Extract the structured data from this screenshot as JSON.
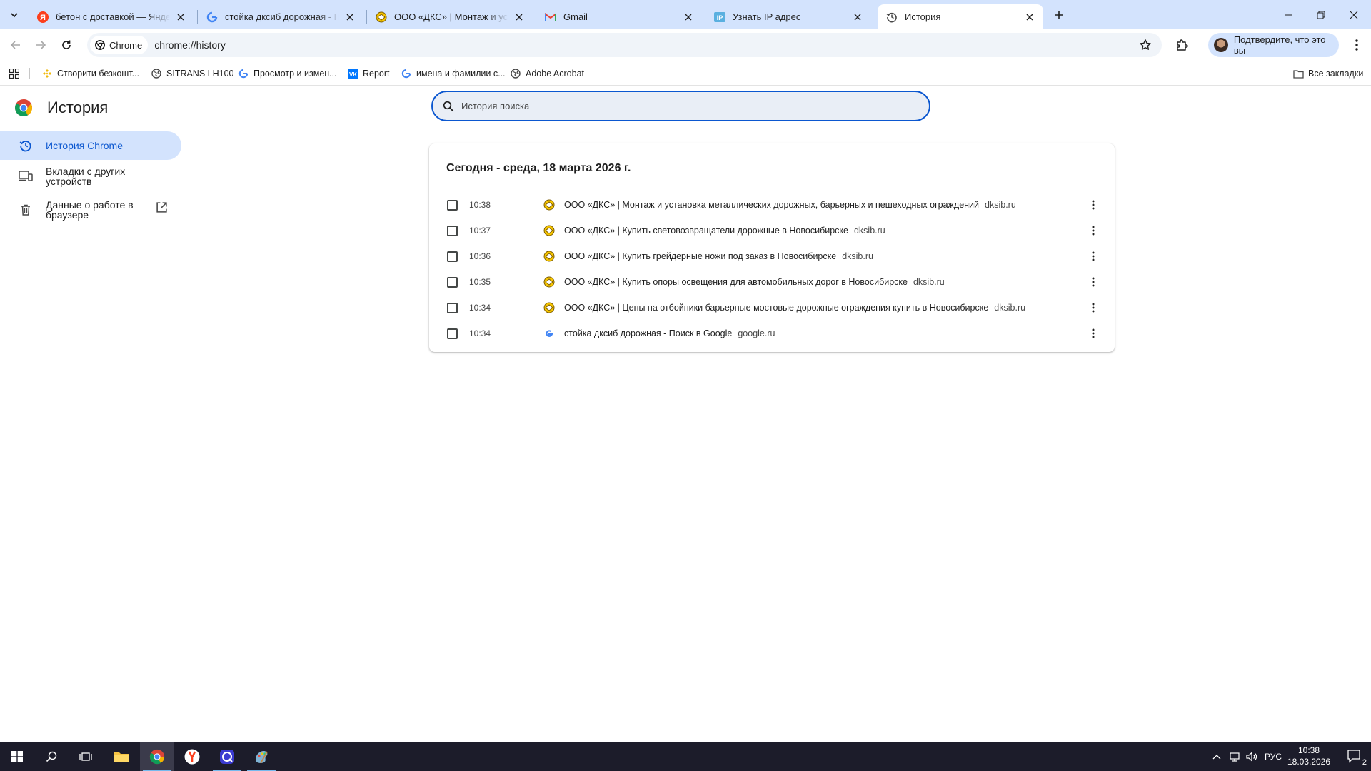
{
  "tabs": [
    {
      "title": "бетон с доставкой — Яндекс: на",
      "favicon": "yandex-icon"
    },
    {
      "title": "стойка дксиб дорожная - Поиск",
      "favicon": "google-icon"
    },
    {
      "title": "ООО «ДКС» | Монтаж и установ",
      "favicon": "dks-icon"
    },
    {
      "title": "Gmail",
      "favicon": "gmail-icon"
    },
    {
      "title": "Узнать IP адрес",
      "favicon": "ip-icon"
    },
    {
      "title": "История",
      "favicon": "history-icon",
      "active": true
    }
  ],
  "toolbar": {
    "chip_label": "Chrome",
    "url": "chrome://history",
    "profile_label": "Подтвердите, что это вы"
  },
  "bookmarks": [
    {
      "label": "Створити безкошт...",
      "icon": "binance-icon"
    },
    {
      "label": "SITRANS LH100",
      "icon": "globe-icon"
    },
    {
      "label": "Просмотр и измен...",
      "icon": "google-icon"
    },
    {
      "label": "Report",
      "icon": "vk-icon"
    },
    {
      "label": "имена и фамилии с...",
      "icon": "google-icon"
    },
    {
      "label": "Adobe Acrobat",
      "icon": "globe-icon"
    }
  ],
  "all_bookmarks_label": "Все закладки",
  "page": {
    "title": "История",
    "search_placeholder": "История поиска"
  },
  "sidebar": {
    "items": [
      {
        "label": "История Chrome",
        "icon": "history-icon",
        "active": true
      },
      {
        "label": "Вкладки с других устройств",
        "icon": "devices-icon"
      },
      {
        "label": "Данные о работе в браузере",
        "icon": "trash-icon"
      }
    ]
  },
  "history": {
    "date_heading": "Сегодня - среда, 18 марта 2026 г.",
    "entries": [
      {
        "time": "10:38",
        "title": "ООО «ДКС» | Монтаж и установка металлических дорожных, барьерных и пешеходных ограждений",
        "domain": "dksib.ru",
        "icon": "dks-icon"
      },
      {
        "time": "10:37",
        "title": "ООО «ДКС» | Купить световозвращатели дорожные в Новосибирске",
        "domain": "dksib.ru",
        "icon": "dks-icon"
      },
      {
        "time": "10:36",
        "title": "ООО «ДКС» | Купить грейдерные ножи под заказ в Новосибирске",
        "domain": "dksib.ru",
        "icon": "dks-icon"
      },
      {
        "time": "10:35",
        "title": "ООО «ДКС» | Купить опоры освещения для автомобильных дорог в Новосибирске",
        "domain": "dksib.ru",
        "icon": "dks-icon"
      },
      {
        "time": "10:34",
        "title": "ООО «ДКС» | Цены на отбойники барьерные мостовые дорожные ограждения купить в Новосибирске",
        "domain": "dksib.ru",
        "icon": "dks-icon"
      },
      {
        "time": "10:34",
        "title": "стойка дксиб дорожная - Поиск в Google",
        "domain": "google.ru",
        "icon": "google-icon"
      }
    ]
  },
  "taskbar": {
    "language": "РУС",
    "time": "10:38",
    "date": "18.03.2026",
    "notifications_count": "2"
  },
  "colors": {
    "tabstrip": "#d3e3fd",
    "accent": "#0b57d0",
    "taskbar": "#1c1c2a"
  }
}
